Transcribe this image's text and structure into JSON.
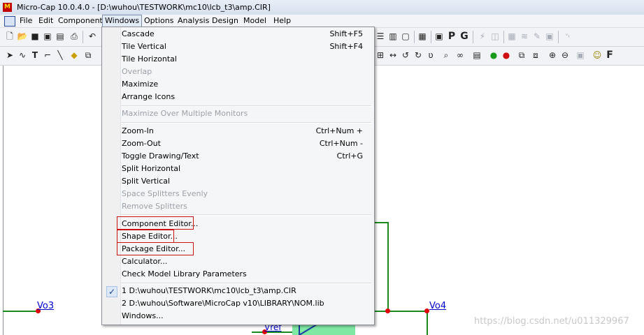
{
  "window": {
    "app_icon_text": "M",
    "title": "Micro-Cap 10.0.4.0 - [D:\\wuhou\\TESTWORK\\mc10\\lcb_t3\\amp.CIR]"
  },
  "menubar": {
    "items": [
      "File",
      "Edit",
      "Component",
      "Windows",
      "Options",
      "Analysis",
      "Design",
      "Model",
      "Help"
    ],
    "active": "Windows"
  },
  "toolbar1": {
    "icons": [
      "new-file-icon",
      "open-folder-icon",
      "save-icon",
      "save-all-icon",
      "print-preview-icon",
      "print-icon",
      "undo-icon",
      "grid-view-icon",
      "tile-view-icon",
      "split-view-icon",
      "window-icon",
      "calculator-icon",
      "properties-icon",
      "p-icon",
      "g-icon",
      "probe-icon",
      "scope-icon",
      "grid-icon",
      "wave-icon",
      "pen-icon",
      "cap-icon",
      "vt-icon"
    ],
    "glyph_p": "P",
    "glyph_g": "G"
  },
  "toolbar2": {
    "icons": [
      "select-arrow-icon",
      "wave-tool-icon",
      "text-tool-icon",
      "wire-tool-icon",
      "line-tool-icon",
      "diamond-icon",
      "draw-tool-icon",
      "flip-h-icon",
      "rotate-icon",
      "rotate-left-icon",
      "rotate-right-icon",
      "mirror-icon",
      "find-icon",
      "binoculars-icon",
      "info-icon",
      "green-run-icon",
      "red-stop-icon",
      "copy-icon",
      "paste-icon",
      "zoom-in-icon",
      "zoom-out-icon",
      "fit-icon",
      "help-icon",
      "f-icon"
    ],
    "glyph_f": "F"
  },
  "windows_menu": {
    "items": [
      {
        "label": "Cascade",
        "shortcut": "Shift+F5",
        "enabled": true
      },
      {
        "label": "Tile Vertical",
        "shortcut": "Shift+F4",
        "enabled": true
      },
      {
        "label": "Tile Horizontal",
        "shortcut": "",
        "enabled": true
      },
      {
        "label": "Overlap",
        "shortcut": "",
        "enabled": false
      },
      {
        "label": "Maximize",
        "shortcut": "",
        "enabled": true
      },
      {
        "label": "Arrange Icons",
        "shortcut": "",
        "enabled": true
      },
      {
        "label": "Maximize Over Multiple Monitors",
        "shortcut": "",
        "enabled": false
      },
      {
        "label": "Zoom-In",
        "shortcut": "Ctrl+Num +",
        "enabled": true
      },
      {
        "label": "Zoom-Out",
        "shortcut": "Ctrl+Num -",
        "enabled": true
      },
      {
        "label": "Toggle Drawing/Text",
        "shortcut": "Ctrl+G",
        "enabled": true
      },
      {
        "label": "Split Horizontal",
        "shortcut": "",
        "enabled": true
      },
      {
        "label": "Split Vertical",
        "shortcut": "",
        "enabled": true
      },
      {
        "label": "Space Splitters Evenly",
        "shortcut": "",
        "enabled": false
      },
      {
        "label": "Remove Splitters",
        "shortcut": "",
        "enabled": false
      },
      {
        "label": "Component Editor...",
        "shortcut": "",
        "enabled": true,
        "highlighted_box": true
      },
      {
        "label": "Shape Editor...",
        "shortcut": "",
        "enabled": true,
        "highlighted_box": true
      },
      {
        "label": "Package Editor...",
        "shortcut": "",
        "enabled": true,
        "highlighted_box": true
      },
      {
        "label": "Calculator...",
        "shortcut": "",
        "enabled": true
      },
      {
        "label": "Check Model Library Parameters",
        "shortcut": "",
        "enabled": true
      },
      {
        "label": "1 D:\\wuhou\\TESTWORK\\mc10\\lcb_t3\\amp.CIR",
        "shortcut": "",
        "enabled": true,
        "checked": true
      },
      {
        "label": "2 D:\\wuhou\\Software\\MicroCap v10\\LIBRARY\\NOM.lib",
        "shortcut": "",
        "enabled": true
      },
      {
        "label": "Windows...",
        "shortcut": "",
        "enabled": true
      }
    ],
    "check_glyph": "✓"
  },
  "schematic": {
    "labels": [
      "Vo3",
      "Vo4",
      "Vref"
    ],
    "wire_color": "#1a8a1a",
    "node_color": "#e00000",
    "label_color": "#0000d0"
  },
  "watermark": "https://blog.csdn.net/u011329967"
}
